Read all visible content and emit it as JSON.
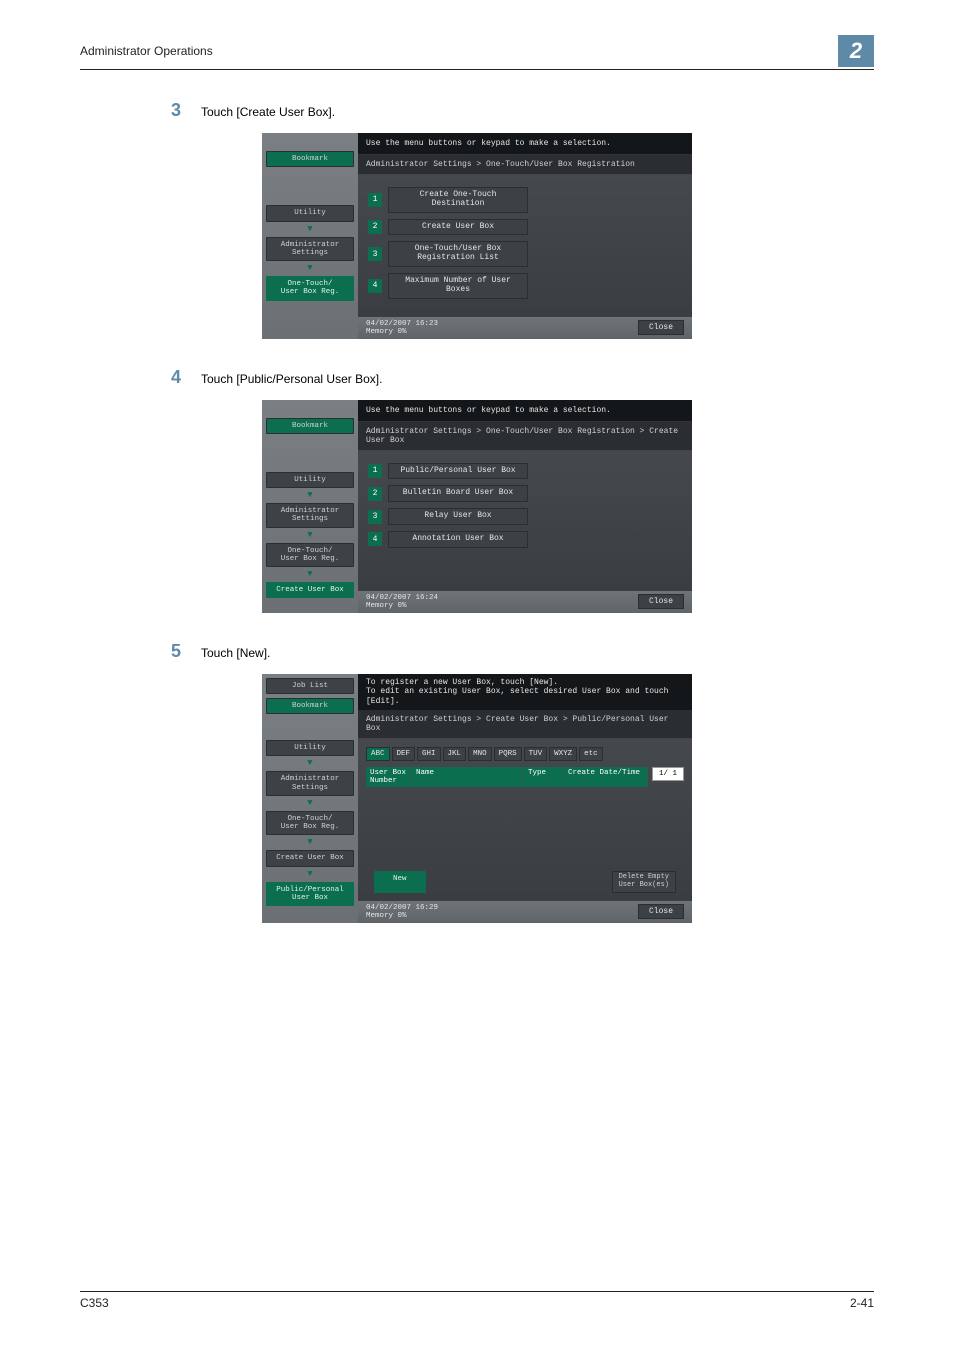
{
  "header": {
    "section": "Administrator Operations",
    "chapter": "2"
  },
  "steps": [
    {
      "num": "3",
      "text": "Touch [Create User Box]."
    },
    {
      "num": "4",
      "text": "Touch [Public/Personal User Box]."
    },
    {
      "num": "5",
      "text": "Touch [New]."
    }
  ],
  "screen1": {
    "prompt": "Use the menu buttons or keypad to make a selection.",
    "breadcrumb": "Administrator Settings > One-Touch/User Box Registration",
    "side": {
      "bookmark": "Bookmark",
      "utility": "Utility",
      "admin": "Administrator\nSettings",
      "onetouch": "One-Touch/\nUser Box Reg."
    },
    "menu": [
      {
        "n": "1",
        "label": "Create One-Touch\nDestination"
      },
      {
        "n": "2",
        "label": "Create User Box"
      },
      {
        "n": "3",
        "label": "One-Touch/User Box\nRegistration List"
      },
      {
        "n": "4",
        "label": "Maximum Number of User Boxes"
      }
    ],
    "datetime": "04/02/2007   16:23",
    "memory": "Memory        0%",
    "close": "Close"
  },
  "screen2": {
    "prompt": "Use the menu buttons or keypad to make a selection.",
    "breadcrumb": "Administrator Settings > One-Touch/User Box Registration > Create User Box",
    "side": {
      "bookmark": "Bookmark",
      "utility": "Utility",
      "admin": "Administrator\nSettings",
      "onetouch": "One-Touch/\nUser Box Reg.",
      "create": "Create User Box"
    },
    "menu": [
      {
        "n": "1",
        "label": "Public/Personal User Box"
      },
      {
        "n": "2",
        "label": "Bulletin Board User Box"
      },
      {
        "n": "3",
        "label": "Relay User Box"
      },
      {
        "n": "4",
        "label": "Annotation User Box"
      }
    ],
    "datetime": "04/02/2007   16:24",
    "memory": "Memory        0%",
    "close": "Close"
  },
  "screen3": {
    "prompt1": "To register a new User Box, touch [New].",
    "prompt2": "To edit an existing User Box, select desired User Box and touch [Edit].",
    "breadcrumb": "Administrator Settings > Create User Box > Public/Personal User Box",
    "side": {
      "joblist": "Job List",
      "bookmark": "Bookmark",
      "utility": "Utility",
      "admin": "Administrator\nSettings",
      "onetouch": "One-Touch/\nUser Box Reg.",
      "create": "Create User Box",
      "pub": "Public/Personal\nUser Box"
    },
    "tabs": [
      "ABC",
      "DEF",
      "GHI",
      "JKL",
      "MNO",
      "PQRS",
      "TUV",
      "WXYZ",
      "etc"
    ],
    "columns": [
      "User Box\nNumber",
      "Name",
      "Type",
      "Create Date/Time"
    ],
    "page": "1/  1",
    "new": "New",
    "delete": "Delete Empty\nUser Box(es)",
    "datetime": "04/02/2007   16:29",
    "memory": "Memory        0%",
    "close": "Close"
  },
  "footer": {
    "left": "C353",
    "right": "2-41"
  }
}
